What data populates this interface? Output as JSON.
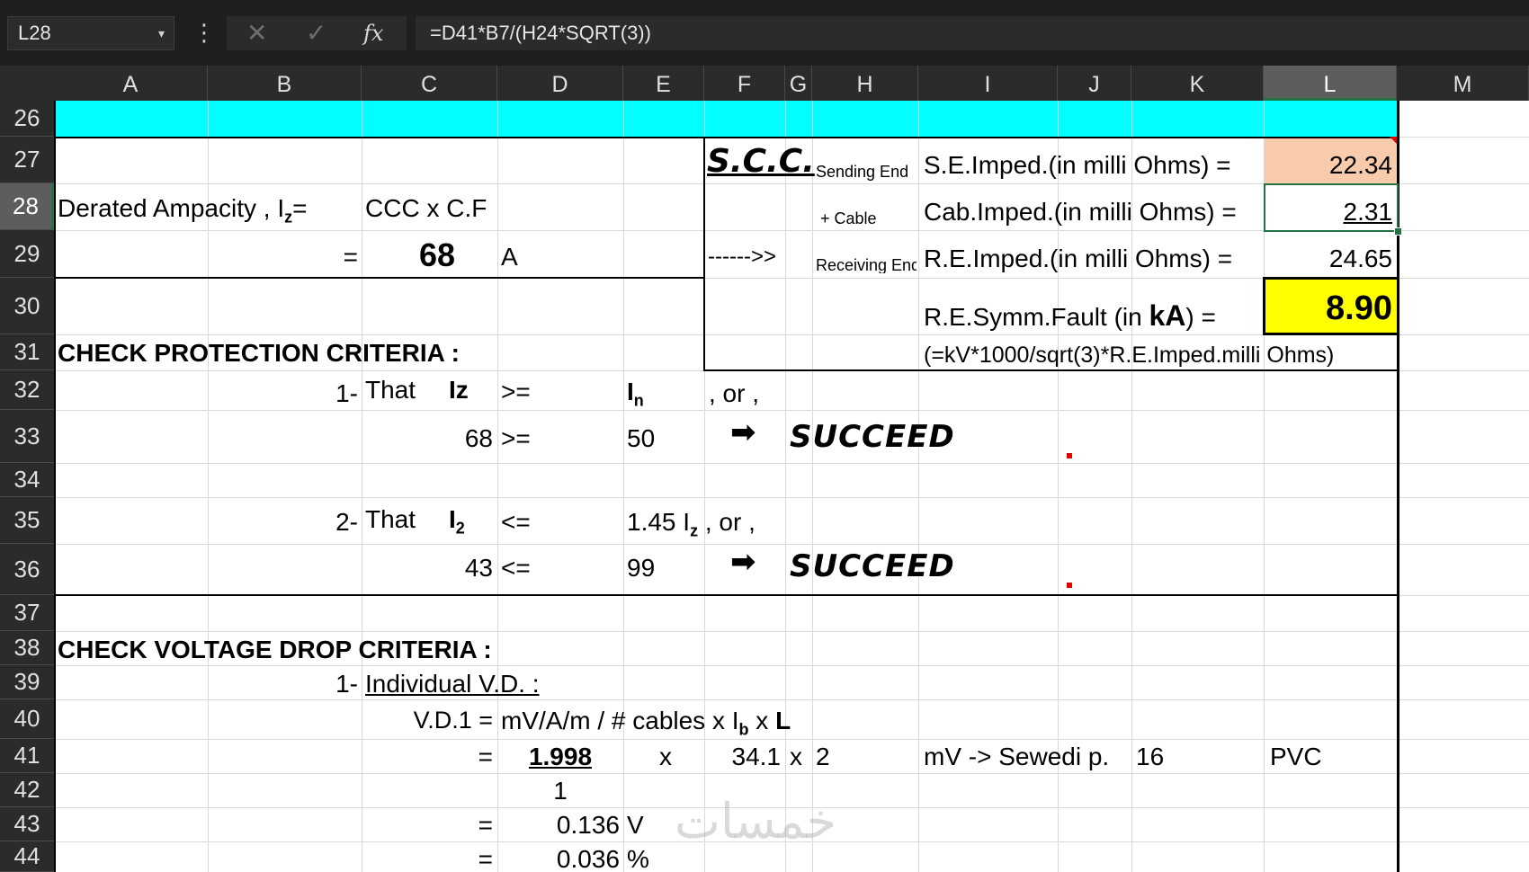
{
  "formula_bar": {
    "name_box": "L28",
    "dropdown_icon": "▾",
    "more_icon": "⋮",
    "cancel_icon": "✕",
    "enter_icon": "✓",
    "fx_label": "fx",
    "formula": "=D41*B7/(H24*SQRT(3))"
  },
  "columns": [
    "A",
    "B",
    "C",
    "D",
    "E",
    "F",
    "G",
    "H",
    "I",
    "J",
    "K",
    "L",
    "M"
  ],
  "selected_column": "L",
  "rows": [
    "26",
    "27",
    "28",
    "29",
    "30",
    "31",
    "32",
    "33",
    "34",
    "35",
    "36",
    "37",
    "38",
    "39",
    "40",
    "41",
    "42",
    "43",
    "44"
  ],
  "selected_row": "28",
  "colors": {
    "banner_fill": "#00FFFF",
    "se_imped_fill": "#F8CBAD",
    "fault_fill": "#FFFF00",
    "selection": "#217346",
    "header_bg": "#2B2B2B"
  },
  "cells": {
    "A28_label": "Derated Ampacity , I",
    "A28_sub": "z",
    "A28_eq": "=",
    "C28": "CCC x C.F",
    "B29": "=",
    "C29": "68",
    "D29": "A",
    "F27": "S.C.C.",
    "H27": "Sending End",
    "I27": "S.E.Imped.(in milli Ohms) =",
    "L27": "22.34",
    "H28": "+ Cable",
    "I28": "Cab.Imped.(in milli Ohms) =",
    "L28": "2.31",
    "F29": "------>>",
    "H29": "Receiving End",
    "I29": "R.E.Imped.(in milli Ohms) =",
    "L29": "24.65",
    "I30_a": "R.E.Symm.Fault  (in ",
    "I30_b": "kA",
    "I30_c": ") =",
    "L30": "8.90",
    "I31": "(=kV*1000/sqrt(3)*R.E.Imped.milli Ohms)",
    "A31": "CHECK PROTECTION CRITERIA :",
    "B32": "1-",
    "C32": "That",
    "C32_b": "Iz",
    "D32": ">=",
    "E32": "I",
    "E32_sub": "n",
    "F32": ", or ,",
    "C33": "68",
    "D33": ">=",
    "E33": "50",
    "F33_icon": "➡",
    "G33": "SUCCEED",
    "B35": "2-",
    "C35": "That",
    "C35_b": "I",
    "C35_sub": "2",
    "D35": "<=",
    "E35_a": "1.45 I",
    "E35_sub": "z",
    "E35_b": " , or ,",
    "C36": "43",
    "D36": "<=",
    "E36": "99",
    "F36_icon": "➡",
    "G36": "SUCCEED",
    "A38": "CHECK VOLTAGE DROP CRITERIA :",
    "B39": "1-",
    "C39": "Individual V.D. :",
    "C40": "V.D.1 =",
    "D40_a": "mV/A/m / # cables x I",
    "D40_sub": "b",
    "D40_b": " x ",
    "D40_c": "L",
    "C41": "=",
    "D41": "1.998",
    "E41": "x",
    "F41": "34.1",
    "G41": "x",
    "H41": "2",
    "I41": "mV -> Sewedi p.",
    "K41": "16",
    "L41": "PVC",
    "D42": "1",
    "C43": "=",
    "D43": "0.136",
    "E43": "V",
    "C44": "=",
    "D44": "0.036",
    "E44": "%"
  }
}
